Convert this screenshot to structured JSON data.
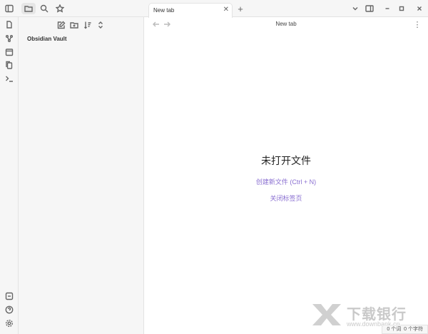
{
  "sidebar": {
    "vault_name": "Obsidian Vault"
  },
  "tabs": [
    {
      "label": "New tab"
    }
  ],
  "nav": {
    "title": "New tab"
  },
  "empty_state": {
    "title": "未打开文件",
    "create_link": "创建新文件 (Ctrl + N)",
    "close_link": "关闭标签页"
  },
  "status": {
    "words": "0 个词",
    "chars": "0 个字符"
  },
  "watermark": {
    "brand": "下载银行",
    "url": "www.downbank.cn"
  },
  "colors": {
    "accent": "#8a6fd1"
  }
}
